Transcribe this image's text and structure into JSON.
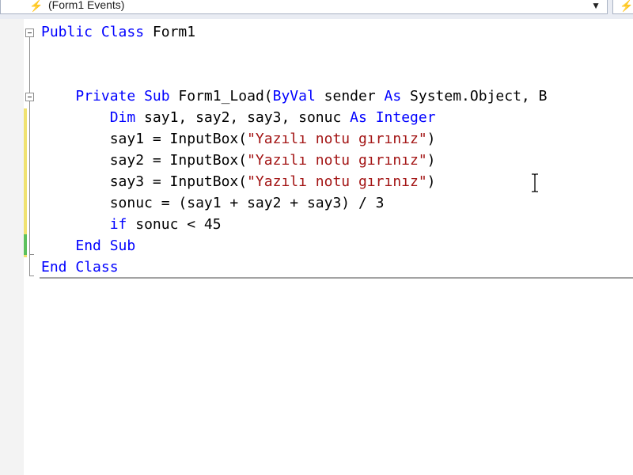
{
  "toolbar": {
    "events_dropdown": {
      "icon": "lightning-bolt-icon",
      "label": "(Form1 Events)"
    },
    "right_dropdown": {
      "icon": "lightning-bolt-icon"
    }
  },
  "code": {
    "lines": [
      {
        "id": "l1",
        "tokens": [
          {
            "t": "Public",
            "c": "kw"
          },
          {
            "t": " ",
            "c": ""
          },
          {
            "t": "Class",
            "c": "kw"
          },
          {
            "t": " Form1",
            "c": ""
          }
        ]
      },
      {
        "id": "l4",
        "tokens": [
          {
            "t": "    ",
            "c": ""
          },
          {
            "t": "Private",
            "c": "kw"
          },
          {
            "t": " ",
            "c": ""
          },
          {
            "t": "Sub",
            "c": "kw"
          },
          {
            "t": " Form1_Load(",
            "c": ""
          },
          {
            "t": "ByVal",
            "c": "kw"
          },
          {
            "t": " sender ",
            "c": ""
          },
          {
            "t": "As",
            "c": "kw"
          },
          {
            "t": " System.Object, B",
            "c": ""
          }
        ]
      },
      {
        "id": "l5",
        "tokens": [
          {
            "t": "        ",
            "c": ""
          },
          {
            "t": "Dim",
            "c": "kw"
          },
          {
            "t": " say1, say2, say3, sonuc ",
            "c": ""
          },
          {
            "t": "As",
            "c": "kw"
          },
          {
            "t": " ",
            "c": ""
          },
          {
            "t": "Integer",
            "c": "kw"
          }
        ]
      },
      {
        "id": "l6",
        "tokens": [
          {
            "t": "        say1 = InputBox(",
            "c": ""
          },
          {
            "t": "\"Yazılı notu gırınız\"",
            "c": "str"
          },
          {
            "t": ")",
            "c": ""
          }
        ]
      },
      {
        "id": "l7",
        "tokens": [
          {
            "t": "        say2 = InputBox(",
            "c": ""
          },
          {
            "t": "\"Yazılı notu gırınız\"",
            "c": "str"
          },
          {
            "t": ")",
            "c": ""
          }
        ]
      },
      {
        "id": "l8",
        "tokens": [
          {
            "t": "        say3 = InputBox(",
            "c": ""
          },
          {
            "t": "\"Yazılı notu gırınız\"",
            "c": "str"
          },
          {
            "t": ")",
            "c": ""
          }
        ]
      },
      {
        "id": "l9",
        "tokens": [
          {
            "t": "        sonuc = (say1 + say2 + say3) / 3",
            "c": ""
          }
        ]
      },
      {
        "id": "l10",
        "tokens": [
          {
            "t": "        ",
            "c": ""
          },
          {
            "t": "if",
            "c": "kw"
          },
          {
            "t": " sonuc < 45",
            "c": ""
          }
        ]
      },
      {
        "id": "l11",
        "tokens": [
          {
            "t": "    ",
            "c": ""
          },
          {
            "t": "End",
            "c": "kw"
          },
          {
            "t": " ",
            "c": ""
          },
          {
            "t": "Sub",
            "c": "kw"
          }
        ]
      },
      {
        "id": "l12",
        "tokens": [
          {
            "t": "End",
            "c": "kw"
          },
          {
            "t": " ",
            "c": ""
          },
          {
            "t": "Class",
            "c": "kw"
          }
        ]
      }
    ]
  },
  "cursor": {
    "icon": "text-ibeam-cursor-icon"
  },
  "colors": {
    "keyword": "#0000ff",
    "string": "#a31515",
    "text": "#000000",
    "changed_bar": "#f0e270",
    "saved_bar": "#5cc15c"
  }
}
